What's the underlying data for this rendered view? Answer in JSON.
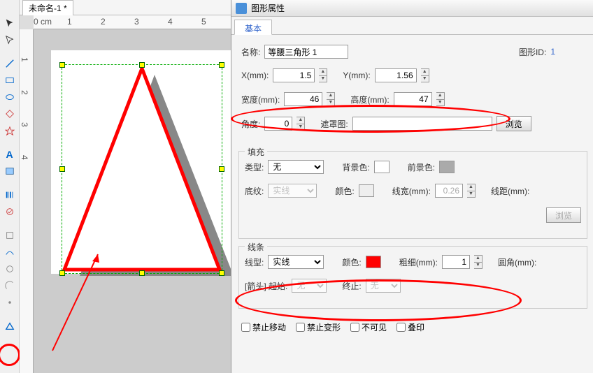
{
  "document": {
    "tab_name": "未命名-1 *"
  },
  "ruler": {
    "unit_label": "0 cm",
    "marks": [
      "1",
      "2",
      "3",
      "4",
      "5"
    ]
  },
  "panel": {
    "title": "图形属性",
    "tab_basic": "基本",
    "name_label": "名称:",
    "name_value": "等腰三角形 1",
    "shape_id_label": "图形ID:",
    "shape_id_value": "1",
    "x_label": "X(mm):",
    "x_value": "1.5",
    "y_label": "Y(mm):",
    "y_value": "1.56",
    "width_label": "宽度(mm):",
    "width_value": "46",
    "height_label": "高度(mm):",
    "height_value": "47",
    "angle_label": "角度:",
    "angle_value": "0",
    "mask_label": "遮罩图:",
    "browse": "浏览"
  },
  "fill": {
    "group": "填充",
    "type_label": "类型:",
    "type_value": "无",
    "bgcolor_label": "背景色:",
    "fgcolor_label": "前景色:",
    "pattern_label": "底纹:",
    "pattern_value": "实线",
    "color_label": "颜色:",
    "linewidth_label": "线宽(mm):",
    "linewidth_value": "0.26",
    "linegap_label": "线距(mm):",
    "browse": "浏览"
  },
  "stroke": {
    "group": "线条",
    "type_label": "线型:",
    "type_value": "实线",
    "color_label": "颜色:",
    "weight_label": "粗细(mm):",
    "weight_value": "1",
    "corner_label": "圆角(mm):",
    "arrow_label": "[箭头] 起始:",
    "arrow_start": "无",
    "end_label": "终止:",
    "arrow_end": "无"
  },
  "checks": {
    "no_move": "禁止移动",
    "no_transform": "禁止变形",
    "invisible": "不可见",
    "overprint": "叠印"
  }
}
